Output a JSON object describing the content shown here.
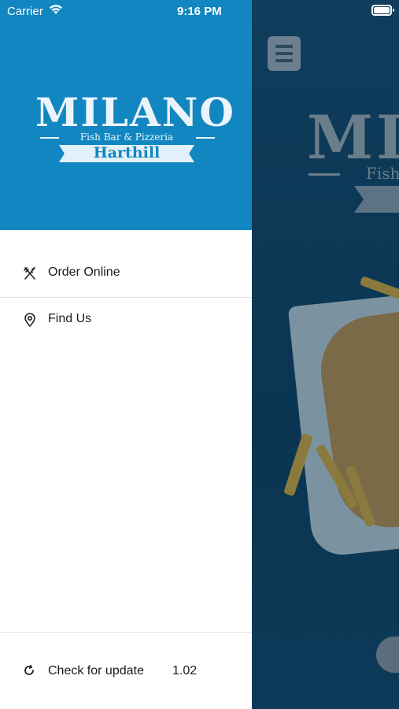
{
  "status_bar": {
    "carrier": "Carrier",
    "time": "9:16 PM"
  },
  "logo": {
    "title": "MILANO",
    "subtitle": "Fish Bar & Pizzeria",
    "city": "Harthill"
  },
  "background": {
    "logo_title": "MILANO",
    "logo_subtitle": "Fish Bar & Pizzeria"
  },
  "menu": {
    "items": [
      {
        "label": "Order Online",
        "icon": "fork-knife-icon"
      },
      {
        "label": "Find Us",
        "icon": "location-pin-icon"
      }
    ]
  },
  "footer": {
    "update_label": "Check for update",
    "version": "1.02",
    "icon": "refresh-icon"
  },
  "colors": {
    "header_blue": "#1186c0",
    "background_overlay": "#0f3a56"
  }
}
